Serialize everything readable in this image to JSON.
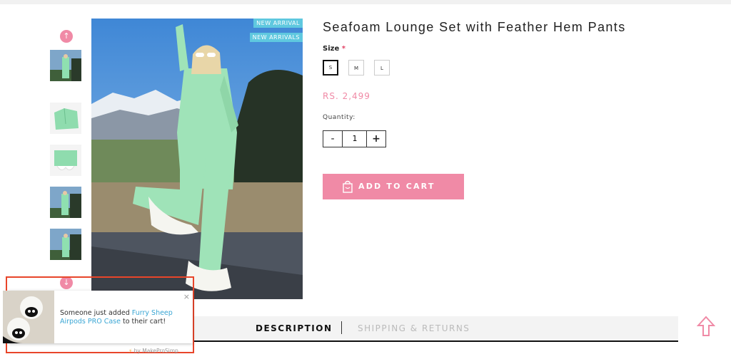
{
  "product": {
    "title": "Seafoam Lounge Set with Feather Hem Pants",
    "badges": [
      "NEW ARRIVAL",
      "NEW ARRIVALS"
    ],
    "size_label": "Size",
    "required_mark": "*",
    "sizes": [
      {
        "label": "S",
        "selected": true
      },
      {
        "label": "M",
        "selected": false
      },
      {
        "label": "L",
        "selected": false
      }
    ],
    "price": "RS. 2,499",
    "quantity_label": "Quantity:",
    "quantity_value": "1",
    "qty_minus": "-",
    "qty_plus": "+",
    "add_to_cart": "ADD TO CART"
  },
  "gallery": {
    "up_icon": "chevron-up-icon",
    "down_icon": "chevron-down-icon",
    "thumbnail_count": 5
  },
  "tabs": {
    "description": "DESCRIPTION",
    "shipping": "SHIPPING & RETURNS"
  },
  "notification": {
    "prefix": "Someone just added ",
    "product": "Furry Sheep Airpods PRO Case",
    "suffix": " to their cart!",
    "close": "×",
    "credit": "by MakeProSimp",
    "credit_icon": "⚡"
  },
  "colors": {
    "accent_pink": "#f08aa6",
    "badge_blue": "#5fc8df",
    "link_blue": "#3aa6d4",
    "highlight_red": "#e8452a"
  }
}
